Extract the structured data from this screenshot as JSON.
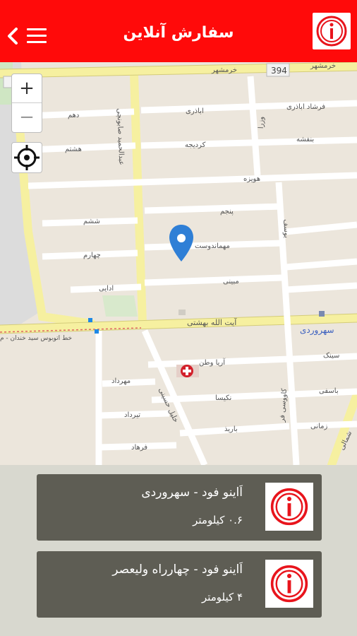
{
  "header": {
    "title": "سفارش آنلاین",
    "menu_icon": "hamburger-menu-icon",
    "back_icon": "chevron-left-icon",
    "logo_icon": "brand-logo-icon",
    "bg_color": "#ff0a0a"
  },
  "map": {
    "zoom_in_label": "+",
    "zoom_out_label": "−",
    "streets": {
      "khorramshahr": "خرمشهر",
      "khorramshahr2": "خرمشهر",
      "route_394": "394",
      "ayati": "اباذری",
      "farshad": "فرشاد اباذری",
      "dahom": "دهم",
      "hashtom": "هشتم",
      "kordjeh": "کردیجه",
      "banafsheh": "بنفشه",
      "hoveyzeh": "هویزه",
      "panjom": "پنجم",
      "sheshom": "ششم",
      "chaharom": "چهارم",
      "mehmandoost": "مهماندوست",
      "adabi": "ادایی",
      "mobini": "مبینی",
      "beheshti": "آیت الله بهشتی",
      "sohrevardi": "سهروردی",
      "siyami": "سینک",
      "arya": "آریا وطن",
      "mehrdad": "مهرداد",
      "nekisa": "نکیسا",
      "tirdad": "تیرداد",
      "baarid": "باریذ",
      "farhad": "فرهاد",
      "zamani": "زمانی",
      "bahmani": "باسفی",
      "yousef": "یوسف",
      "vozara": "وزرا",
      "abdolhamid": "عبدالحمید صابونچی",
      "khalil": "خلیل حسینی",
      "kavoosi": "کاووسی فر",
      "bus_line": "خط اتوبوس سید خندان - م",
      "shomali": "شمالی"
    }
  },
  "branches": [
    {
      "name": "اَاینو فود - سهروردی",
      "distance": "۰.۶ کیلومتر"
    },
    {
      "name": "اَاینو فود - چهارراه ولیعصر",
      "distance": "۴ کیلومتر"
    }
  ],
  "colors": {
    "card_bg": "#5e5d54",
    "accent": "#ff0a0a",
    "pin": "#2f7fd6"
  }
}
